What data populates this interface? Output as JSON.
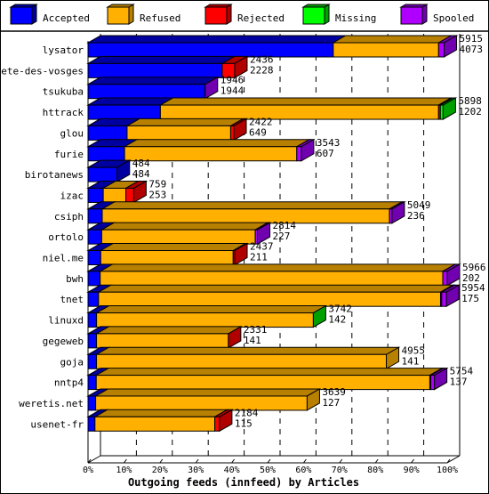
{
  "chart_data": {
    "type": "bar",
    "orientation": "horizontal",
    "stacked": true,
    "title": "Outgoing feeds (innfeed) by Articles",
    "xlabel": "Outgoing feeds (innfeed) by Articles",
    "ylabel": "",
    "xlim": [
      0,
      100
    ],
    "x_ticks": [
      "0%",
      "10%",
      "20%",
      "30%",
      "40%",
      "50%",
      "60%",
      "70%",
      "80%",
      "90%",
      "100%"
    ],
    "grid": true,
    "legend_position": "top",
    "legend": [
      {
        "name": "Accepted",
        "color": "#0000ff",
        "dark": "#0000a0"
      },
      {
        "name": "Refused",
        "color": "#ffb000",
        "dark": "#b88000"
      },
      {
        "name": "Rejected",
        "color": "#ff0000",
        "dark": "#b00000"
      },
      {
        "name": "Missing",
        "color": "#00ff00",
        "dark": "#00a000"
      },
      {
        "name": "Spooled",
        "color": "#af00ff",
        "dark": "#7000b0"
      }
    ],
    "scale_max": 5966,
    "categories": [
      "lysator",
      "bete-des-vosges",
      "tsukuba",
      "httrack",
      "glou",
      "furie",
      "birotanews",
      "izac",
      "csiph",
      "ortolo",
      "niel.me",
      "bwh",
      "tnet",
      "linuxd",
      "gegeweb",
      "goja",
      "nntp4",
      "weretis.net",
      "usenet-fr"
    ],
    "offered": [
      5915,
      2436,
      1946,
      5898,
      2422,
      3543,
      484,
      759,
      5049,
      2814,
      2437,
      5966,
      5954,
      3742,
      2331,
      4955,
      5754,
      3639,
      2184
    ],
    "accepted": [
      4073,
      2228,
      1944,
      1202,
      649,
      607,
      484,
      253,
      236,
      227,
      211,
      202,
      175,
      142,
      141,
      141,
      137,
      127,
      115
    ],
    "series": [
      {
        "name": "Accepted",
        "values": [
          4073,
          2228,
          1944,
          1202,
          649,
          607,
          484,
          253,
          236,
          227,
          211,
          202,
          175,
          142,
          141,
          141,
          137,
          127,
          115
        ]
      },
      {
        "name": "Refused",
        "values": [
          1750,
          0,
          0,
          4620,
          1720,
          2860,
          0,
          375,
          4770,
          2550,
          2200,
          5690,
          5680,
          3600,
          2190,
          4814,
          5540,
          3512,
          1990
        ]
      },
      {
        "name": "Rejected",
        "values": [
          0,
          208,
          0,
          30,
          53,
          0,
          0,
          131,
          0,
          0,
          26,
          0,
          20,
          0,
          0,
          0,
          15,
          0,
          79
        ]
      },
      {
        "name": "Missing",
        "values": [
          0,
          0,
          0,
          46,
          0,
          0,
          0,
          0,
          0,
          0,
          0,
          0,
          0,
          0,
          0,
          0,
          0,
          0,
          0
        ]
      },
      {
        "name": "Spooled",
        "values": [
          92,
          0,
          2,
          0,
          0,
          76,
          0,
          0,
          43,
          37,
          0,
          74,
          79,
          0,
          0,
          0,
          62,
          0,
          0
        ]
      }
    ],
    "end_caps": [
      "Spooled",
      "Rejected",
      "Spooled",
      "Missing",
      "Rejected",
      "Spooled",
      "Accepted",
      "Rejected",
      "Spooled",
      "Spooled",
      "Rejected",
      "Spooled",
      "Spooled",
      "Missing",
      "Rejected",
      "Refused",
      "Spooled",
      "Refused",
      "Rejected"
    ]
  }
}
